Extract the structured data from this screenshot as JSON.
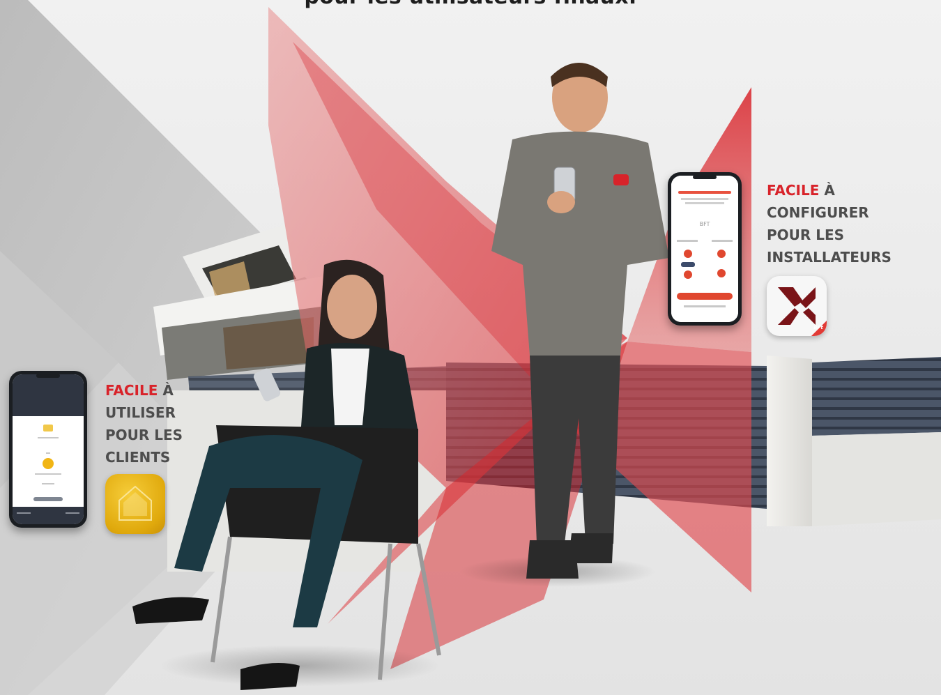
{
  "headline": "pour les utilisateurs finaux.",
  "installer_callout": {
    "highlight": "FACILE",
    "rest": "À",
    "lines": [
      "CONFIGURER",
      "POUR LES",
      "INSTALLATEURS"
    ]
  },
  "client_callout": {
    "highlight": "FACILE",
    "rest": "À",
    "lines": [
      "UTILISER",
      "POUR LES",
      "CLIENTS"
    ]
  },
  "installer_app_icon": {
    "name": "bft-x-app-icon",
    "brand_label": "BFt"
  },
  "client_app_icon": {
    "name": "house-app-icon"
  },
  "colors": {
    "accent_red": "#d8232a",
    "text_grey": "#4d4d4d",
    "app_yellow": "#e8b317",
    "gate_blue": "#4b5668"
  }
}
